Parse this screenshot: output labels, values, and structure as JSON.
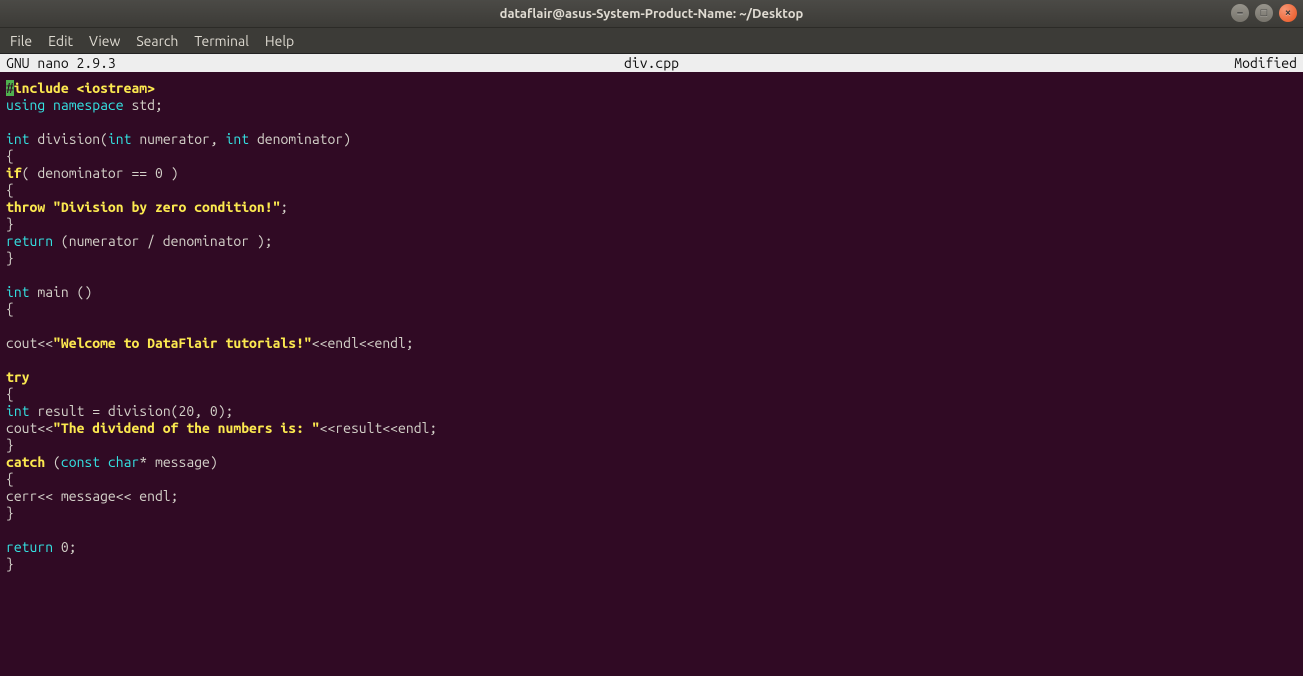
{
  "window": {
    "title": "dataflair@asus-System-Product-Name: ~/Desktop"
  },
  "menubar": {
    "items": [
      "File",
      "Edit",
      "View",
      "Search",
      "Terminal",
      "Help"
    ]
  },
  "nano": {
    "version": "GNU nano 2.9.3",
    "filename": "div.cpp",
    "modified": "Modified"
  },
  "code": {
    "l01": {
      "hash": "#",
      "include": "include ",
      "hdr": "<iostream>"
    },
    "l02": {
      "using": "using ",
      "ns": "namespace ",
      "std": "std;"
    },
    "l04": {
      "int1": "int ",
      "fn": "division(",
      "int2": "int ",
      "p1": "numerator, ",
      "int3": "int ",
      "p2": "denominator)"
    },
    "l05": {
      "b": "{"
    },
    "l06": {
      "if": "if",
      "cond": "( denominator == 0 )"
    },
    "l07": {
      "b": "{"
    },
    "l08": {
      "throw": "throw ",
      "str": "\"Division by zero condition!\"",
      "semi": ";"
    },
    "l09": {
      "b": "}"
    },
    "l10": {
      "ret": "return ",
      "expr": "(numerator / denominator );"
    },
    "l11": {
      "b": "}"
    },
    "l13": {
      "int": "int ",
      "main": "main ()"
    },
    "l14": {
      "b": "{"
    },
    "l16": {
      "a": "cout<<",
      "str": "\"Welcome to DataFlair tutorials!\"",
      "b": "<<endl<<endl;"
    },
    "l18": {
      "try": "try"
    },
    "l19": {
      "b": "{"
    },
    "l20": {
      "int": "int ",
      "rest": "result = division(20, 0);"
    },
    "l21": {
      "a": "cout<<",
      "str": "\"The dividend of the numbers is: \"",
      "b": "<<result<<endl;"
    },
    "l22": {
      "b": "}"
    },
    "l23": {
      "catch": "catch ",
      "paren": "(",
      "const": "const ",
      "char": "char",
      "rest": "* message)"
    },
    "l24": {
      "b": "{"
    },
    "l25": {
      "a": "cerr<< message<< endl;"
    },
    "l26": {
      "b": "}"
    },
    "l28": {
      "ret": "return ",
      "z": "0;"
    },
    "l29": {
      "b": "}"
    }
  }
}
